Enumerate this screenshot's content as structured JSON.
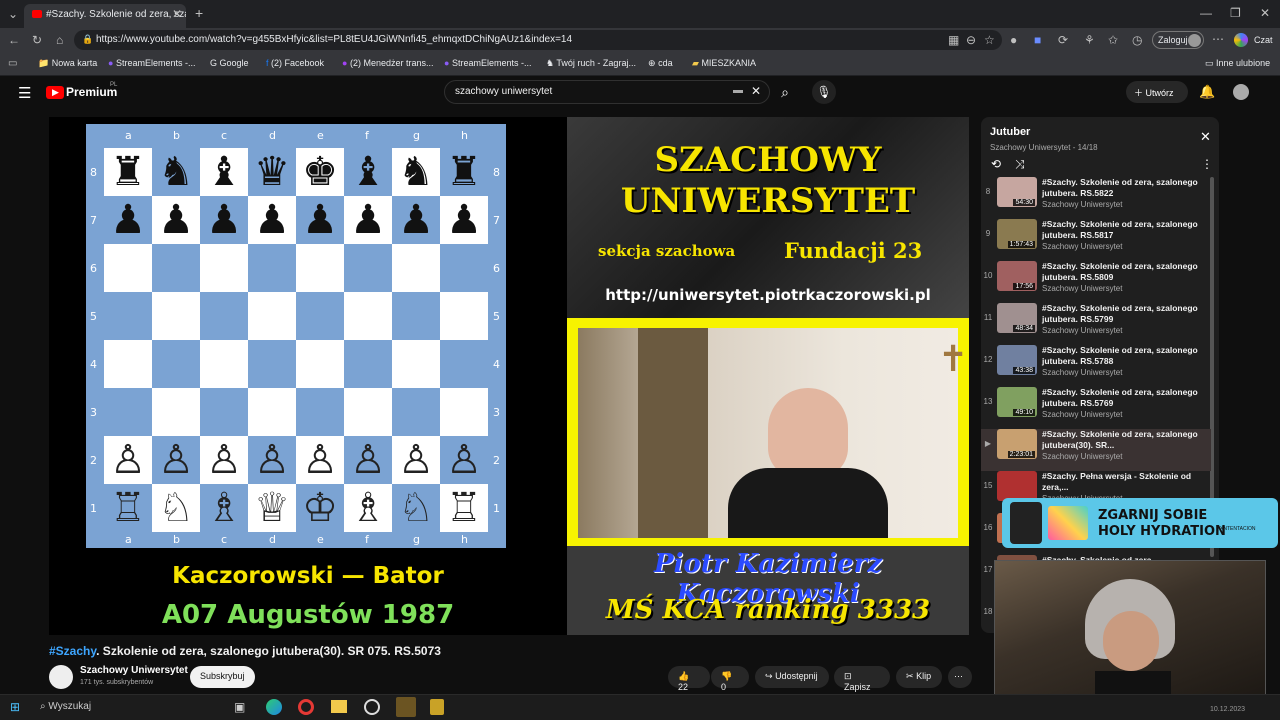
{
  "browser": {
    "tab_title": "#Szachy. Szkolenie od zera, szalon",
    "new_tab_label": "+",
    "url": "https://www.youtube.com/watch?v=g455BxHfyic&list=PL8tEU4JGiWNnfi45_ehmqxtDChiNgAUz1&index=14",
    "login_label": "Zaloguj",
    "chat_label": "Czat",
    "bookmarks": [
      "Nowa karta",
      "StreamElements -...",
      "Google",
      "(2) Facebook",
      "(2) Menedżer trans...",
      "StreamElements -...",
      "Twój ruch - Zagraj...",
      "cda",
      "MIESZKANIA"
    ],
    "other_bookmarks": "Inne ulubione"
  },
  "youtube": {
    "logo": "Premium",
    "logo_suffix": "PL",
    "search_value": "szachowy uniwersytet",
    "create_label": "Utwórz"
  },
  "board": {
    "files": [
      "a",
      "b",
      "c",
      "d",
      "e",
      "f",
      "g",
      "h"
    ],
    "ranks": [
      "8",
      "7",
      "6",
      "5",
      "4",
      "3",
      "2",
      "1"
    ],
    "game_title_1": "Kaczorowski — Bator",
    "game_title_2": "A07 Augustów 1987"
  },
  "banner": {
    "line1": "SZACHOWY",
    "line2": "UNIWERSYTET",
    "line3a": "sekcja szachowa",
    "line3b": "Fundacji 23",
    "url": "http://uniwersytet.piotrkaczorowski.pl",
    "name": "Piotr Kazimierz Kaczorowski",
    "ranking": "MŚ KCA ranking 3333"
  },
  "video": {
    "hashtag": "#Szachy",
    "title": ". Szkolenie od zera, szalonego jutubera(30). SR 075. RS.5073",
    "channel": "Szachowy Uniwersytet",
    "subscribers": "171 tys. subskrybentów",
    "subscribe_label": "Subskrybuj",
    "likes": "22",
    "dislikes": "0",
    "share_label": "Udostępnij",
    "save_label": "Zapisz",
    "clip_label": "Klip"
  },
  "playlist": {
    "title": "Jutuber",
    "subtitle": "Szachowy Uniwersytet - 14/18",
    "items": [
      {
        "num": "8",
        "title": "#Szachy. Szkolenie od zera, szalonego jutubera. RS.5822",
        "channel": "Szachowy Uniwersytet",
        "duration": "54:30"
      },
      {
        "num": "9",
        "title": "#Szachy. Szkolenie od zera, szalonego jutubera. RS.5817",
        "channel": "Szachowy Uniwersytet",
        "duration": "1:57:43"
      },
      {
        "num": "10",
        "title": "#Szachy. Szkolenie od zera, szalonego jutubera. RS.5809",
        "channel": "Szachowy Uniwersytet",
        "duration": "17:56"
      },
      {
        "num": "11",
        "title": "#Szachy. Szkolenie od zera, szalonego jutubera. RS.5799",
        "channel": "Szachowy Uniwersytet",
        "duration": "48:34"
      },
      {
        "num": "12",
        "title": "#Szachy. Szkolenie od zera, szalonego jutubera. RS.5788",
        "channel": "Szachowy Uniwersytet",
        "duration": "43:38"
      },
      {
        "num": "13",
        "title": "#Szachy. Szkolenie od zera, szalonego jutubera. RS.5769",
        "channel": "Szachowy Uniwersytet",
        "duration": "49:10"
      },
      {
        "num": "▶",
        "title": "#Szachy. Szkolenie od zera, szalonego jutubera(30). SR...",
        "channel": "Szachowy Uniwersytet",
        "duration": "2:23:01"
      },
      {
        "num": "15",
        "title": "#Szachy. Pełna wersja - Szkolenie od zera,...",
        "channel": "Szachowy Uniwersytet",
        "duration": ""
      },
      {
        "num": "16",
        "title": "",
        "channel": "",
        "duration": ""
      },
      {
        "num": "17",
        "title": "#Szachy. Szkolenie od zera",
        "channel": "",
        "duration": ""
      },
      {
        "num": "18",
        "title": "",
        "channel": "",
        "duration": ""
      }
    ]
  },
  "ad": {
    "line1": "ZGARNIJ SOBIE",
    "line2": "HOLY HYDRATION",
    "brand": "XNTENTACION"
  },
  "taskbar": {
    "search_label": "Wyszukaj",
    "date": "10.12.2023"
  }
}
